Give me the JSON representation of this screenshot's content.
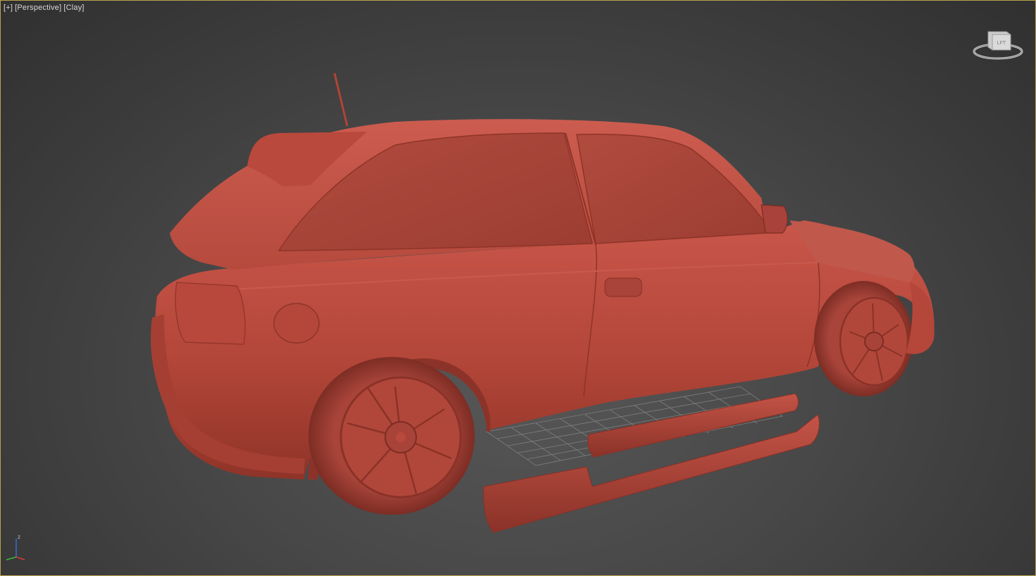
{
  "viewport": {
    "labels": {
      "plus": "[+]",
      "view": "[Perspective]",
      "shading": "[Clay]"
    },
    "viewcube": {
      "face_label": "LFT",
      "icon": "viewcube-icon"
    },
    "axis": {
      "z_label": "z",
      "icon": "axis-tripod-icon"
    },
    "colors": {
      "frame": "#b9a24a",
      "clay": "#b84a3e",
      "background": "#474747"
    }
  },
  "scene": {
    "model": "hatchback-car-clay-model",
    "parts": [
      "car-body",
      "rear-wheel",
      "front-wheel",
      "side-skirt-left",
      "side-skirt-right",
      "ground-grid"
    ]
  }
}
